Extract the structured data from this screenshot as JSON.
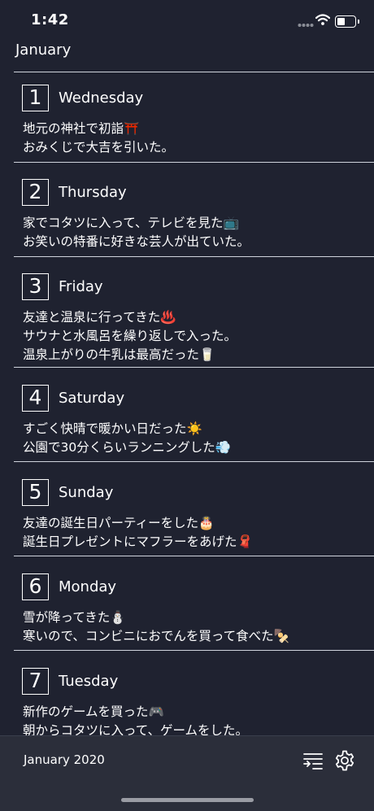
{
  "status_bar": {
    "time": "1:42"
  },
  "header": {
    "month": "January"
  },
  "entries": [
    {
      "day": "1",
      "weekday": "Wednesday",
      "lines": [
        "地元の神社で初詣⛩️",
        "おみくじで大吉を引いた。"
      ]
    },
    {
      "day": "2",
      "weekday": "Thursday",
      "lines": [
        "家でコタツに入って、テレビを見た📺",
        "お笑いの特番に好きな芸人が出ていた。"
      ]
    },
    {
      "day": "3",
      "weekday": "Friday",
      "lines": [
        "友達と温泉に行ってきた♨️",
        "サウナと水風呂を繰り返しで入った。",
        "温泉上がりの牛乳は最高だった🥛"
      ]
    },
    {
      "day": "4",
      "weekday": "Saturday",
      "lines": [
        "すごく快晴で暖かい日だった☀️",
        "公園で30分くらいランニングした💨"
      ]
    },
    {
      "day": "5",
      "weekday": "Sunday",
      "lines": [
        "友達の誕生日パーティーをした🎂",
        "誕生日プレゼントにマフラーをあげた🧣"
      ]
    },
    {
      "day": "6",
      "weekday": "Monday",
      "lines": [
        "雪が降ってきた⛄",
        "寒いので、コンビニにおでんを買って食べた🍢"
      ]
    },
    {
      "day": "7",
      "weekday": "Tuesday",
      "lines": [
        "新作のゲームを買った🎮",
        "朝からコタツに入って、ゲームをした。"
      ]
    }
  ],
  "bottom_bar": {
    "label": "January 2020",
    "sort_icon": "sort-list-icon",
    "settings_icon": "gear-icon"
  },
  "colors": {
    "background": "#1f2230",
    "bottom_bar": "#2b2e3a",
    "text": "#ffffff",
    "divider": "#cfd3dc"
  }
}
